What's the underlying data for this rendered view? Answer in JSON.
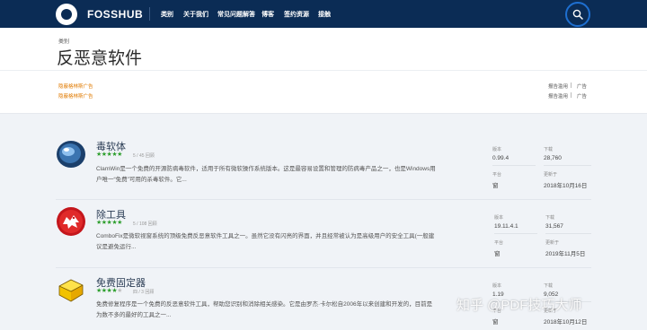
{
  "navbar": {
    "brand": "FOSSHUB",
    "items": [
      "类别",
      "关于我们",
      "常见问题解答",
      "博客",
      "签约资源",
      "接触"
    ]
  },
  "header": {
    "breadcrumb": "类别",
    "title": "反恶意软件",
    "ads_left": [
      "隐蔽格林斯广告",
      "隐蔽格林斯广告"
    ],
    "ads_right": [
      {
        "report": "报告滥用",
        "ad": "广告"
      },
      {
        "report": "报告滥用",
        "ad": "广告"
      }
    ]
  },
  "apps": [
    {
      "name": "毒软体",
      "stars": "★★★★★",
      "empty_stars": "",
      "rating": "5 / 45 回顾",
      "description": "ClamWin是一个免费的开源防病毒软件，适用于所有微软操作系统版本。这是最容易设置和管理的防病毒产品之一，也是Windows用户唯一“免费”可用的杀毒软件。它...",
      "meta": {
        "version_label": "版本",
        "version": "0.99.4",
        "downloads_label": "下载",
        "downloads": "28,760",
        "platform_label": "平台",
        "platform": "窗",
        "updated_label": "更新于",
        "updated": "2018年10月16日"
      }
    },
    {
      "name": "除工具",
      "stars": "★★★★★",
      "empty_stars": "",
      "rating": "5 / 108 回顾",
      "description": "ComboFix是微软视窗系统的顶级免费反恶意软件工具之一。虽然它没有闪亮的界面，并且经常被认为是高级用户的安全工具(一般建议是避免运行...",
      "meta": {
        "version_label": "版本",
        "version": "19.11.4.1",
        "downloads_label": "下载",
        "downloads": "31,567",
        "platform_label": "平台",
        "platform": "窗",
        "updated_label": "更新于",
        "updated": "2019年11月5日"
      }
    },
    {
      "name": "免费固定器",
      "stars": "★★★★",
      "empty_stars": "★",
      "rating": "四 / 3 回顾",
      "description": "免费修复程序是一个免费的反恶意软件工具，帮助您识别和消除相关感染。它是由罗杰·卡尔松自2006年以来创建和开发的，目前是为数不多的最好的工具之一...",
      "meta": {
        "version_label": "版本",
        "version": "1.19",
        "downloads_label": "下载",
        "downloads": "9,052",
        "platform_label": "平台",
        "platform": "窗",
        "updated_label": "更新于",
        "updated": "2018年10月12日"
      }
    }
  ],
  "watermark": "知乎 @PDF技巧大师",
  "colors": {
    "navbar": "#0b2c55",
    "accent": "#1e6fd0",
    "ad_link": "#e07a00",
    "star": "#2e9f2e"
  }
}
